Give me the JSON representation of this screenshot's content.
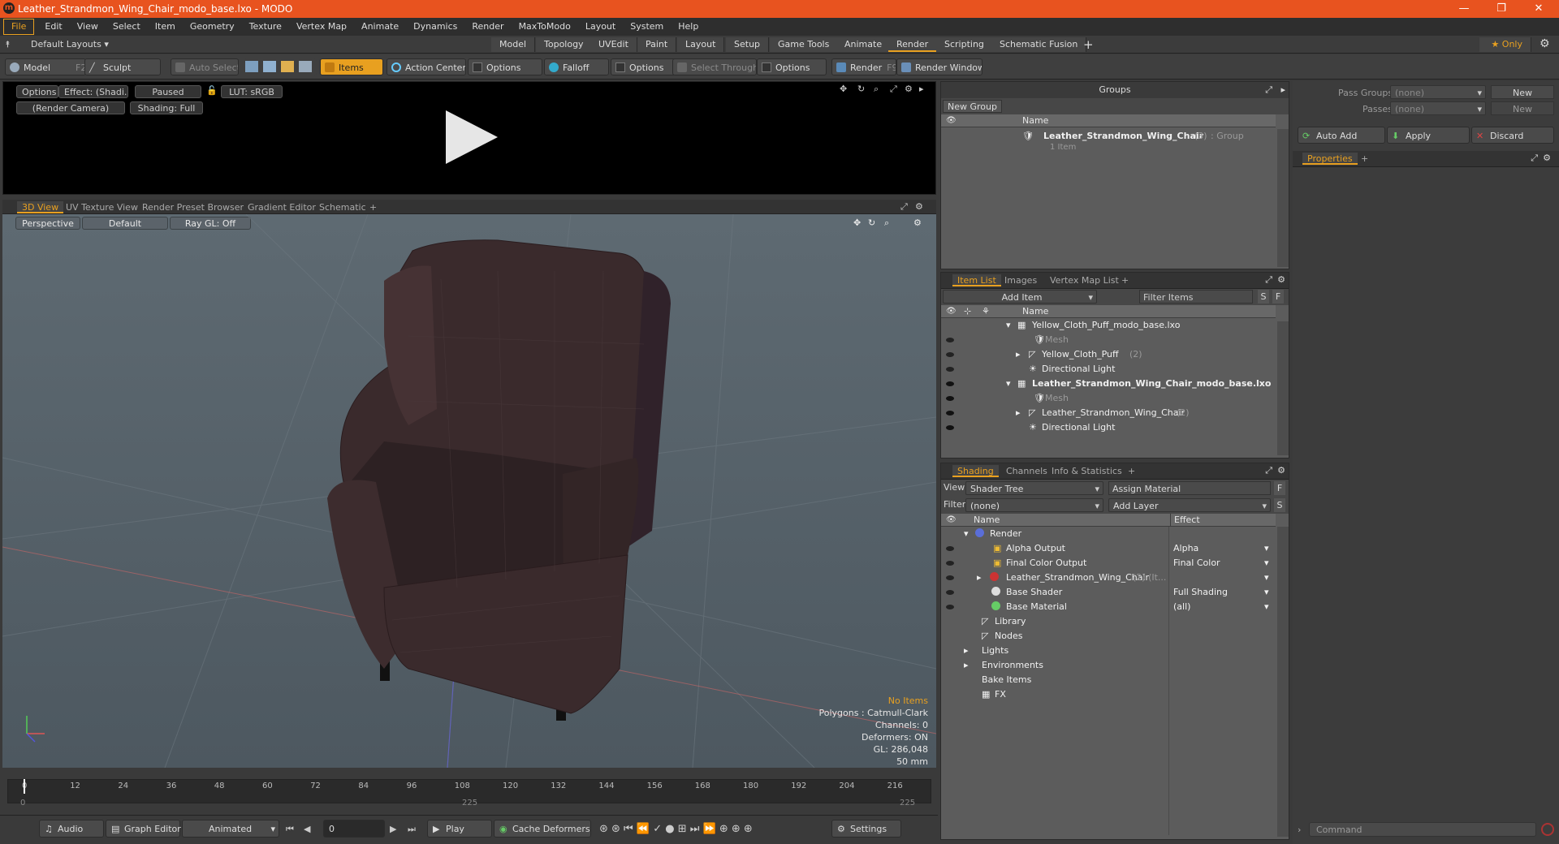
{
  "window": {
    "title": "Leather_Strandmon_Wing_Chair_modo_base.lxo - MODO",
    "logo": "modo-logo-icon",
    "minimize": "—",
    "restore": "❐",
    "close": "✕"
  },
  "menu": [
    "File",
    "Edit",
    "View",
    "Select",
    "Item",
    "Geometry",
    "Texture",
    "Vertex Map",
    "Animate",
    "Dynamics",
    "Render",
    "MaxToModo",
    "Layout",
    "System",
    "Help"
  ],
  "layouts": {
    "selector": "Default Layouts",
    "tabs": [
      "Model",
      "Topology",
      "UVEdit",
      "Paint",
      "Layout",
      "Setup",
      "Game Tools",
      "Animate",
      "Render",
      "Scripting",
      "Schematic Fusion"
    ],
    "active": "Render",
    "add": "+",
    "only": "Only"
  },
  "toolbar": {
    "model": "Model",
    "model_key": "F2",
    "sculpt": "Sculpt",
    "auto_select": "Auto Select",
    "items": "Items",
    "action_center": "Action Center",
    "options1": "Options",
    "falloff": "Falloff",
    "options2": "Options",
    "select_through": "Select Through",
    "options3": "Options",
    "render": "Render",
    "render_key": "F9",
    "render_window": "Render Window"
  },
  "preview": {
    "options": "Options",
    "effect": "Effect: (Shadi...",
    "paused": "Paused",
    "lut": "LUT: sRGB",
    "camera": "(Render Camera)",
    "shading": "Shading: Full"
  },
  "viewtabs": [
    "3D View",
    "UV Texture View",
    "Render Preset Browser",
    "Gradient Editor",
    "Schematic",
    "+"
  ],
  "viewport": {
    "perspective": "Perspective",
    "default": "Default",
    "raygl": "Ray GL: Off",
    "info": {
      "items": "No Items",
      "polygons": "Polygons : Catmull-Clark",
      "channels": "Channels: 0",
      "deformers": "Deformers: ON",
      "gl": "GL: 286,048",
      "mm": "50 mm"
    }
  },
  "timeline": {
    "ticks": [
      "0",
      "12",
      "24",
      "36",
      "48",
      "60",
      "72",
      "84",
      "96",
      "108",
      "120",
      "132",
      "144",
      "156",
      "168",
      "180",
      "192",
      "204",
      "216"
    ],
    "start": "0",
    "mid": "225",
    "end": "225"
  },
  "bottom": {
    "audio": "Audio",
    "graph": "Graph Editor",
    "animated": "Animated",
    "frame": "0",
    "play": "Play",
    "cache": "Cache Deformers",
    "settings": "Settings"
  },
  "groups": {
    "title": "Groups",
    "new_group": "New Group",
    "col_name": "Name",
    "item_name": "Leather_Strandmon_Wing_Chair",
    "item_count": "(3)",
    "item_type": ": Group",
    "item_sub": "1 Item"
  },
  "itemlist": {
    "tabs": [
      "Item List",
      "Images",
      "Vertex Map List",
      "+"
    ],
    "add_item": "Add Item",
    "filter": "Filter Items",
    "s": "S",
    "f": "F",
    "col_name": "Name",
    "rows": [
      {
        "name": "Yellow_Cloth_Puff_modo_base.lxo",
        "count": ""
      },
      {
        "name": "Mesh",
        "count": ""
      },
      {
        "name": "Yellow_Cloth_Puff",
        "count": "(2)"
      },
      {
        "name": "Directional Light",
        "count": ""
      },
      {
        "name": "Leather_Strandmon_Wing_Chair_modo_base.lxo",
        "count": ""
      },
      {
        "name": "Mesh",
        "count": ""
      },
      {
        "name": "Leather_Strandmon_Wing_Chair",
        "count": "(2)"
      },
      {
        "name": "Directional Light",
        "count": ""
      }
    ]
  },
  "shading": {
    "tabs": [
      "Shading",
      "Channels",
      "Info & Statistics",
      "+"
    ],
    "view_label": "View",
    "view_value": "Shader Tree",
    "assign": "Assign Material",
    "filter_label": "Filter",
    "filter_value": "(none)",
    "add_layer": "Add Layer",
    "f": "F",
    "s": "S",
    "col_name": "Name",
    "col_effect": "Effect",
    "rows": [
      {
        "name": "Render",
        "effect": "",
        "count": ""
      },
      {
        "name": "Alpha Output",
        "effect": "Alpha",
        "count": ""
      },
      {
        "name": "Final Color Output",
        "effect": "Final Color",
        "count": ""
      },
      {
        "name": "Leather_Strandmon_Wing_Chair",
        "effect": "",
        "count": "(2) (It..."
      },
      {
        "name": "Base Shader",
        "effect": "Full Shading",
        "count": ""
      },
      {
        "name": "Base Material",
        "effect": "(all)",
        "count": ""
      },
      {
        "name": "Library",
        "effect": "",
        "count": ""
      },
      {
        "name": "Nodes",
        "effect": "",
        "count": ""
      },
      {
        "name": "Lights",
        "effect": "",
        "count": ""
      },
      {
        "name": "Environments",
        "effect": "",
        "count": ""
      },
      {
        "name": "Bake Items",
        "effect": "",
        "count": ""
      },
      {
        "name": "FX",
        "effect": "",
        "count": ""
      }
    ]
  },
  "passes": {
    "pass_groups": "Pass Groups",
    "pass_groups_val": "(none)",
    "new": "New",
    "passes": "Passes",
    "passes_val": "(none)",
    "new2": "New",
    "auto_add": "Auto Add",
    "apply": "Apply",
    "discard": "Discard",
    "properties": "Properties",
    "plus": "+",
    "command": "Command"
  }
}
